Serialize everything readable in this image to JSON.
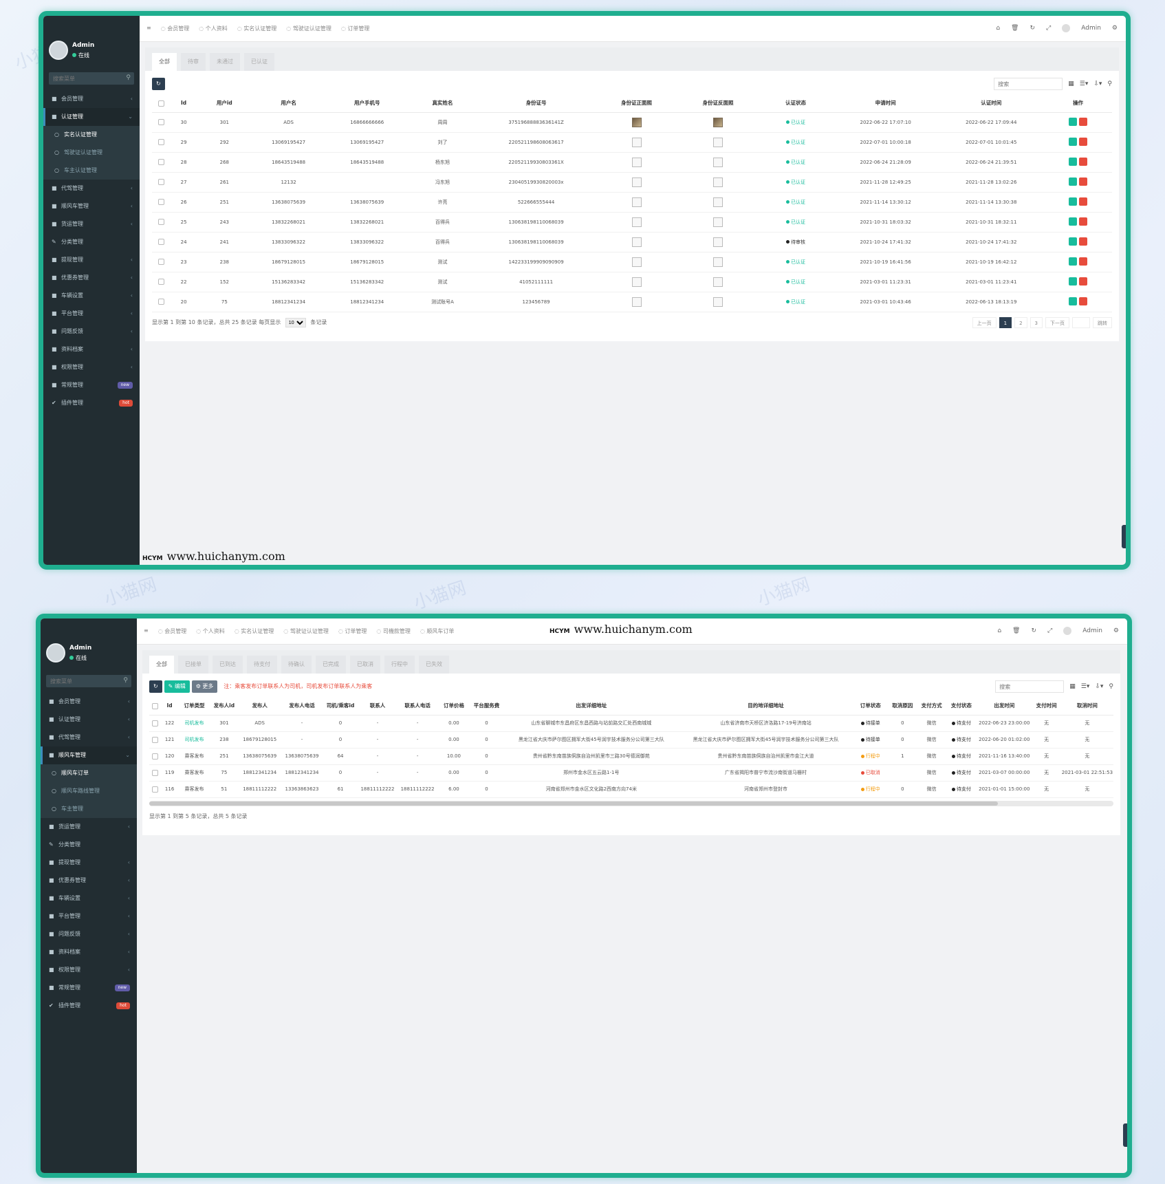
{
  "watermark": "www.huichanym.com",
  "watermark_logo": "HCYM",
  "user": {
    "name": "Admin",
    "status": "在线"
  },
  "search_menu_placeholder": "搜索菜单",
  "top_right": {
    "user": "Admin"
  },
  "screen1": {
    "top_tabs": [
      "会员管理",
      "个人资料",
      "实名认证管理",
      "驾驶证认证管理",
      "订单管理"
    ],
    "menu": [
      {
        "label": "会员管理",
        "icon": "■",
        "arrow": "‹"
      },
      {
        "label": "认证管理",
        "icon": "■",
        "arrow": "⌄",
        "active": true
      },
      {
        "label": "实名认证管理",
        "sub": true,
        "on": true
      },
      {
        "label": "驾驶证认证管理",
        "sub": true
      },
      {
        "label": "车主认证管理",
        "sub": true
      },
      {
        "label": "代驾管理",
        "icon": "■",
        "arrow": "‹"
      },
      {
        "label": "顺风车管理",
        "icon": "■",
        "arrow": "‹"
      },
      {
        "label": "货运管理",
        "icon": "■",
        "arrow": "‹"
      },
      {
        "label": "分类管理",
        "icon": "✎"
      },
      {
        "label": "提现管理",
        "icon": "■",
        "arrow": "‹"
      },
      {
        "label": "优惠券管理",
        "icon": "■",
        "arrow": "‹"
      },
      {
        "label": "车辆设置",
        "icon": "■",
        "arrow": "‹"
      },
      {
        "label": "平台管理",
        "icon": "■",
        "arrow": "‹"
      },
      {
        "label": "问题反馈",
        "icon": "■",
        "arrow": "‹"
      },
      {
        "label": "资料档案",
        "icon": "■",
        "arrow": "‹"
      },
      {
        "label": "权限管理",
        "icon": "■",
        "arrow": "‹"
      },
      {
        "label": "常规管理",
        "icon": "■",
        "badge": "new",
        "badge_type": "new"
      },
      {
        "label": "插件管理",
        "icon": "✔",
        "badge": "hot",
        "badge_type": "hot"
      }
    ],
    "tabs": [
      "全部",
      "待审",
      "未通过",
      "已认证"
    ],
    "search_placeholder": "搜索",
    "columns": [
      "Id",
      "用户id",
      "用户名",
      "用户手机号",
      "真实姓名",
      "身份证号",
      "身份证正面照",
      "身份证反面照",
      "认证状态",
      "申请时间",
      "认证时间",
      "操作"
    ],
    "rows": [
      {
        "id": "30",
        "uid": "301",
        "name": "ADS",
        "phone": "16866666666",
        "real": "周周",
        "idno": "37519688883636141Z",
        "img_real": true,
        "status": "已认证",
        "st": "ok",
        "apply": "2022-06-22 17:07:10",
        "verify": "2022-06-22 17:09:44"
      },
      {
        "id": "29",
        "uid": "292",
        "name": "13069195427",
        "phone": "13069195427",
        "real": "刘了",
        "idno": "220521198608063617",
        "img_real": false,
        "status": "已认证",
        "st": "ok",
        "apply": "2022-07-01 10:00:18",
        "verify": "2022-07-01 10:01:45"
      },
      {
        "id": "28",
        "uid": "268",
        "name": "18643519488",
        "phone": "18643519488",
        "real": "杨东旭",
        "idno": "22052119930803361X",
        "img_real": false,
        "status": "已认证",
        "st": "ok",
        "apply": "2022-06-24 21:28:09",
        "verify": "2022-06-24 21:39:51"
      },
      {
        "id": "27",
        "uid": "261",
        "name": "12132",
        "phone": "",
        "real": "冯东旭",
        "idno": "23040519930820003x",
        "img_real": false,
        "status": "已认证",
        "st": "ok",
        "apply": "2021-11-28 12:49:25",
        "verify": "2021-11-28 13:02:26"
      },
      {
        "id": "26",
        "uid": "251",
        "name": "13638075639",
        "phone": "13638075639",
        "real": "许亮",
        "idno": "522666555444",
        "img_real": false,
        "status": "已认证",
        "st": "ok",
        "apply": "2021-11-14 13:30:12",
        "verify": "2021-11-14 13:30:38"
      },
      {
        "id": "25",
        "uid": "243",
        "name": "13832268021",
        "phone": "13832268021",
        "real": "百得兵",
        "idno": "130638198110068039",
        "img_real": false,
        "status": "已认证",
        "st": "ok",
        "apply": "2021-10-31 18:03:32",
        "verify": "2021-10-31 18:32:11"
      },
      {
        "id": "24",
        "uid": "241",
        "name": "13833096322",
        "phone": "13833096322",
        "real": "百得兵",
        "idno": "130638198110068039",
        "img_real": false,
        "status": "待审核",
        "st": "wait",
        "apply": "2021-10-24 17:41:32",
        "verify": "2021-10-24 17:41:32"
      },
      {
        "id": "23",
        "uid": "238",
        "name": "18679128015",
        "phone": "18679128015",
        "real": "测试",
        "idno": "142233199909090909",
        "img_real": false,
        "status": "已认证",
        "st": "ok",
        "apply": "2021-10-19 16:41:56",
        "verify": "2021-10-19 16:42:12"
      },
      {
        "id": "22",
        "uid": "152",
        "name": "15136283342",
        "phone": "15136283342",
        "real": "测试",
        "idno": "41052111111",
        "img_real": false,
        "status": "已认证",
        "st": "ok",
        "apply": "2021-03-01 11:23:31",
        "verify": "2021-03-01 11:23:41"
      },
      {
        "id": "20",
        "uid": "75",
        "name": "18812341234",
        "phone": "18812341234",
        "real": "测试账号A",
        "idno": "123456789",
        "img_real": false,
        "status": "已认证",
        "st": "ok",
        "apply": "2021-03-01 10:43:46",
        "verify": "2022-06-13 18:13:19"
      }
    ],
    "footer_prefix": "显示第 1 到第 10 条记录，总共 25 条记录 每页显示",
    "page_size": "10",
    "footer_suffix": "条记录",
    "pager": [
      "上一页",
      "1",
      "2",
      "3",
      "下一页"
    ],
    "goto": "跳转"
  },
  "screen2": {
    "top_tabs": [
      "会员管理",
      "个人资料",
      "实名认证管理",
      "驾驶证认证管理",
      "订单管理",
      "司機款管理",
      "顺风车订单"
    ],
    "menu": [
      {
        "label": "会员管理",
        "icon": "■",
        "arrow": "‹"
      },
      {
        "label": "认证管理",
        "icon": "■",
        "arrow": "‹"
      },
      {
        "label": "代驾管理",
        "icon": "■",
        "arrow": "‹"
      },
      {
        "label": "顺风车管理",
        "icon": "■",
        "arrow": "⌄",
        "active": true
      },
      {
        "label": "顺风车订单",
        "sub": true,
        "on": true
      },
      {
        "label": "顺风车路线管理",
        "sub": true
      },
      {
        "label": "车主管理",
        "sub": true
      },
      {
        "label": "货运管理",
        "icon": "■",
        "arrow": "‹"
      },
      {
        "label": "分类管理",
        "icon": "✎"
      },
      {
        "label": "提现管理",
        "icon": "■",
        "arrow": "‹"
      },
      {
        "label": "优惠券管理",
        "icon": "■",
        "arrow": "‹"
      },
      {
        "label": "车辆设置",
        "icon": "■",
        "arrow": "‹"
      },
      {
        "label": "平台管理",
        "icon": "■",
        "arrow": "‹"
      },
      {
        "label": "问题反馈",
        "icon": "■",
        "arrow": "‹"
      },
      {
        "label": "资料档案",
        "icon": "■",
        "arrow": "‹"
      },
      {
        "label": "权限管理",
        "icon": "■",
        "arrow": "‹"
      },
      {
        "label": "常规管理",
        "icon": "■",
        "badge": "new",
        "badge_type": "new"
      },
      {
        "label": "插件管理",
        "icon": "✔",
        "badge": "hot",
        "badge_type": "hot"
      }
    ],
    "tabs": [
      "全部",
      "已接单",
      "已到达",
      "待支付",
      "待确认",
      "已完成",
      "已取消",
      "行程中",
      "已失效"
    ],
    "btn_edit": "编辑",
    "btn_more": "更多",
    "note": "注：乘客发布订单联系人为司机，司机发布订单联系人为乘客",
    "search_placeholder": "搜索",
    "columns": [
      "Id",
      "订单类型",
      "发布人id",
      "发布人",
      "发布人电话",
      "司机/乘客id",
      "联系人",
      "联系人电话",
      "订单价格",
      "平台服务费",
      "出发详细地址",
      "目的地详细地址",
      "订单状态",
      "取消原因",
      "支付方式",
      "支付状态",
      "出发时间",
      "支付时间",
      "取消时间"
    ],
    "rows": [
      {
        "id": "122",
        "type": "司机发布",
        "tg": true,
        "pid": "301",
        "pub": "ADS",
        "pphone": "-",
        "did": "0",
        "cont": "-",
        "cphone": "-",
        "price": "0.00",
        "fee": "0",
        "from": "山东省聊城市东昌府区东昌西路与站前路交汇处西南城城",
        "to": "山东省济南市天桥区济洛路17-19号济南站",
        "status": "待接单",
        "st": "wait",
        "reason": "0",
        "pay": "微信",
        "paystat": "待支付",
        "depart": "2022-06-23 23:00:00",
        "paytime": "无",
        "cancel": "无"
      },
      {
        "id": "121",
        "type": "司机发布",
        "tg": true,
        "pid": "238",
        "pub": "18679128015",
        "pphone": "-",
        "did": "0",
        "cont": "-",
        "cphone": "-",
        "price": "0.00",
        "fee": "0",
        "from": "黑龙江省大庆市萨尔图区拥军大街45号润宇技术服务分公司第三大队",
        "to": "黑龙江省大庆市萨尔图区拥军大街45号润宇技术服务分公司第三大队",
        "status": "待接单",
        "st": "wait",
        "reason": "0",
        "pay": "微信",
        "paystat": "待支付",
        "depart": "2022-06-20 01:02:00",
        "paytime": "无",
        "cancel": "无"
      },
      {
        "id": "120",
        "type": "乘客发布",
        "tg": false,
        "pid": "251",
        "pub": "13638075639",
        "pphone": "13638075639",
        "did": "64",
        "cont": "-",
        "cphone": "-",
        "price": "10.00",
        "fee": "0",
        "from": "贵州省黔东南苗族侗族自治州凯里市三路30号德润御苑",
        "to": "贵州省黔东南苗族侗族自治州凯里市金江大道",
        "status": "行程中",
        "st": "warn",
        "reason": "1",
        "pay": "微信",
        "paystat": "待支付",
        "depart": "2021-11-16 13:40:00",
        "paytime": "无",
        "cancel": "无"
      },
      {
        "id": "119",
        "type": "乘客发布",
        "tg": false,
        "pid": "75",
        "pub": "18812341234",
        "pphone": "18812341234",
        "did": "0",
        "cont": "-",
        "cphone": "-",
        "price": "0.00",
        "fee": "0",
        "from": "郑州市金水区五云路1-1号",
        "to": "广东省揭阳市普宁市流沙南街道马栅村",
        "status": "已取消",
        "st": "red",
        "reason": "",
        "pay": "微信",
        "paystat": "待支付",
        "depart": "2021-03-07 00:00:00",
        "paytime": "无",
        "cancel": "2021-03-01 22:51:53"
      },
      {
        "id": "116",
        "type": "乘客发布",
        "tg": false,
        "pid": "51",
        "pub": "18811112222",
        "pphone": "13363863623",
        "did": "61",
        "cont": "18811112222",
        "cphone": "18811112222",
        "price": "6.00",
        "fee": "0",
        "from": "河南省郑州市金水区文化路2西南方向74米",
        "to": "河南省郑州市登封市",
        "status": "行程中",
        "st": "warn",
        "reason": "0",
        "pay": "微信",
        "paystat": "待支付",
        "depart": "2021-01-01 15:00:00",
        "paytime": "无",
        "cancel": "无"
      }
    ],
    "footer": "显示第 1 到第 5 条记录，总共 5 条记录"
  }
}
